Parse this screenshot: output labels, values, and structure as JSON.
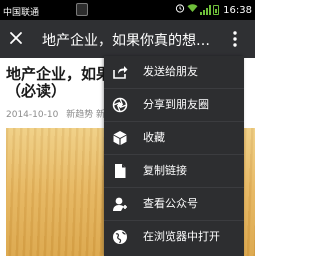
{
  "status_bar": {
    "carrier": "中国联通",
    "clock": "16:38",
    "icons": [
      "notification-icon",
      "alarm-icon",
      "wifi-icon",
      "signal-icon",
      "battery-icon"
    ]
  },
  "top_bar": {
    "title": "地产企业，如果你真的想好...",
    "close_icon": "close-icon",
    "more_icon": "more-vertical-icon"
  },
  "article": {
    "headline_line1": "地产企业，如果你真的想好",
    "headline_line2": "（必读）",
    "date": "2014-10-10",
    "source": "新趋势 新思"
  },
  "menu": {
    "items": [
      {
        "label": "发送给朋友",
        "icon": "share-arrow-icon"
      },
      {
        "label": "分享到朋友圈",
        "icon": "moments-icon"
      },
      {
        "label": "收藏",
        "icon": "favorite-box-icon"
      },
      {
        "label": "复制链接",
        "icon": "copy-link-icon"
      },
      {
        "label": "查看公众号",
        "icon": "official-account-icon"
      },
      {
        "label": "在浏览器中打开",
        "icon": "browser-globe-icon"
      }
    ]
  },
  "colors": {
    "status_bar": "#000000",
    "top_bar": "#2f3033",
    "menu_bg": "#2d2e30",
    "meta_text": "#8c8c8c",
    "signal_green": "#6fbf3a"
  }
}
